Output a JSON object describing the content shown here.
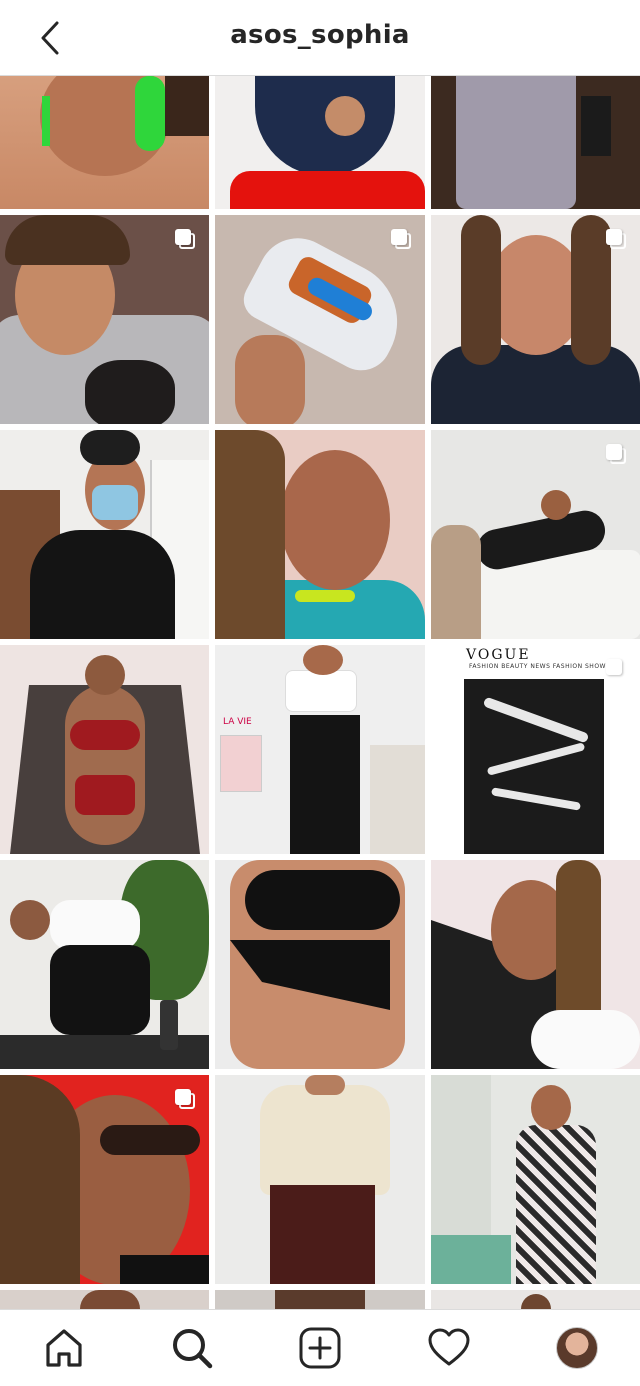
{
  "header": {
    "title": "asos_sophia",
    "back_icon": "chevron-left-icon"
  },
  "grid": {
    "tiles": [
      {
        "row": 0,
        "col": 0,
        "description": "close-up neck green earring",
        "multi": false
      },
      {
        "row": 0,
        "col": 1,
        "description": "navy ribbed top red chair",
        "multi": false
      },
      {
        "row": 0,
        "col": 2,
        "description": "lilac joggers",
        "multi": false
      },
      {
        "row": 1,
        "col": 0,
        "description": "smiling with puppy on sofa",
        "multi": true
      },
      {
        "row": 1,
        "col": 1,
        "description": "hand holding sneaker",
        "multi": true
      },
      {
        "row": 1,
        "col": 2,
        "description": "selfie navy knit",
        "multi": true
      },
      {
        "row": 2,
        "col": 0,
        "description": "mask selfie hallway",
        "multi": false
      },
      {
        "row": 2,
        "col": 1,
        "description": "smiling portrait",
        "multi": false
      },
      {
        "row": 2,
        "col": 2,
        "description": "photoshoot on bed",
        "multi": true
      },
      {
        "row": 3,
        "col": 0,
        "description": "red lingerie kimono",
        "multi": false
      },
      {
        "row": 3,
        "col": 1,
        "description": "white crop top black trousers",
        "multi": false
      },
      {
        "row": 3,
        "col": 2,
        "description": "vogue article screenshot",
        "multi": true
      },
      {
        "row": 4,
        "col": 0,
        "description": "yoga camel pose",
        "multi": false
      },
      {
        "row": 4,
        "col": 1,
        "description": "black bra and briefs",
        "multi": false
      },
      {
        "row": 4,
        "col": 2,
        "description": "off shoulder sweater",
        "multi": false
      },
      {
        "row": 5,
        "col": 0,
        "description": "kissy face selfie",
        "multi": true
      },
      {
        "row": 5,
        "col": 1,
        "description": "cream knit cardigan",
        "multi": false
      },
      {
        "row": 5,
        "col": 2,
        "description": "check jumpsuit kitchen",
        "multi": false
      }
    ],
    "vogue_logo": "VOGUE",
    "vogue_nav": "FASHION  BEAUTY  NEWS  FASHION SHOWS",
    "lavie": "LA VIE"
  },
  "nav": {
    "items": [
      {
        "name": "home",
        "icon": "home-icon"
      },
      {
        "name": "search",
        "icon": "search-icon"
      },
      {
        "name": "new-post",
        "icon": "plus-square-icon"
      },
      {
        "name": "activity",
        "icon": "heart-icon"
      },
      {
        "name": "profile",
        "icon": "avatar"
      }
    ]
  }
}
